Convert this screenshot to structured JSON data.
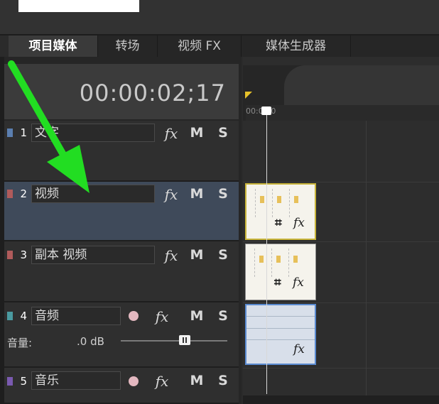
{
  "tabs": [
    {
      "label": "项目媒体",
      "active": true
    },
    {
      "label": "转场",
      "active": false
    },
    {
      "label": "视频 FX",
      "active": false
    },
    {
      "label": "媒体生成器",
      "active": false
    }
  ],
  "timecode": "00:00:02;17",
  "ruler_label": "00:00:0",
  "tracks": [
    {
      "number": "1",
      "type": "video",
      "name": "文字",
      "fx": "fx",
      "mute": "M",
      "solo": "S",
      "selected": false
    },
    {
      "number": "2",
      "type": "video",
      "name": "视频",
      "fx": "fx",
      "mute": "M",
      "solo": "S",
      "selected": true
    },
    {
      "number": "3",
      "type": "video",
      "name": "副本 视频",
      "fx": "fx",
      "mute": "M",
      "solo": "S",
      "selected": false
    },
    {
      "number": "4",
      "type": "audio",
      "name": "音频",
      "fx": "fx",
      "mute": "M",
      "solo": "S",
      "selected": false
    },
    {
      "number": "5",
      "type": "audio",
      "name": "音乐",
      "fx": "fx",
      "mute": "M",
      "solo": "S",
      "selected": false
    }
  ],
  "volume": {
    "label": "音量:",
    "value": ".0 dB",
    "level": 0.55
  },
  "clip_icons": {
    "crop": "⌗",
    "fx": "fx"
  },
  "colors": {
    "selected_track": "#3f4a5a",
    "annotation_arrow": "#22dd22",
    "timeline_marker": "#e6c12a",
    "clip_selected_border": "#c8b43a",
    "audio_clip_border": "#5a8ad0"
  },
  "annotation": {
    "icon": "green-arrow-icon"
  }
}
